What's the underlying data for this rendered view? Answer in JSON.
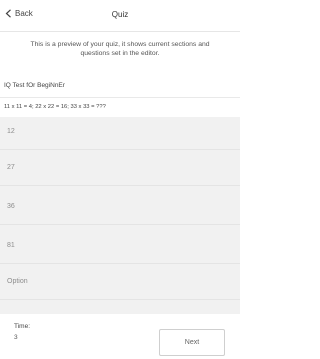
{
  "nav": {
    "back_label": "Back",
    "title": "Quiz"
  },
  "intro_text": "This is a preview of your quiz, it shows current sections and questions set in the editor.",
  "quiz": {
    "name": "IQ Test fOr BegiNnEr",
    "question": "11 x 11 = 4; 22 x 22 = 16; 33 x 33 = ???",
    "options": [
      "12",
      "27",
      "36",
      "81",
      "Option"
    ]
  },
  "footer": {
    "time_label": "Time:",
    "time_value": "3",
    "next_label": "Next"
  }
}
